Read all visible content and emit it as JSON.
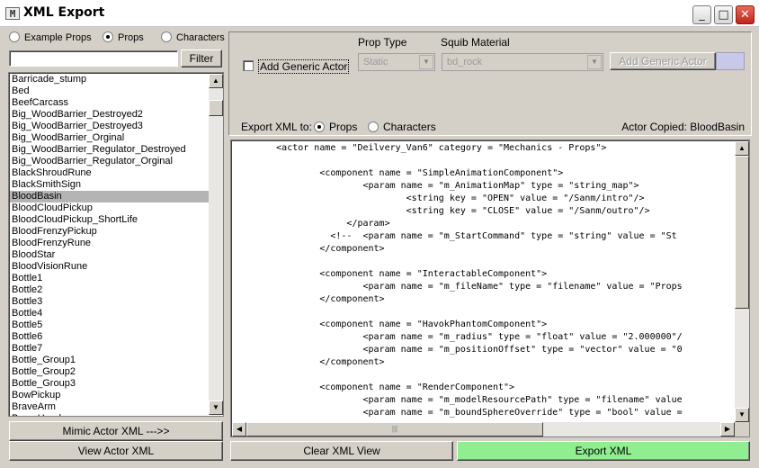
{
  "window": {
    "title": "XML Export",
    "app_icon": "M",
    "buttons": {
      "minimize": "_",
      "maximize": "□",
      "close": "✕"
    }
  },
  "left": {
    "radios": [
      {
        "label": "Example Props",
        "selected": false
      },
      {
        "label": "Props",
        "selected": true
      },
      {
        "label": "Characters",
        "selected": false
      }
    ],
    "filter_value": "",
    "filter_button": "Filter",
    "list_items": [
      "Barricade_stump",
      "Bed",
      "BeefCarcass",
      "Big_WoodBarrier_Destroyed2",
      "Big_WoodBarrier_Destroyed3",
      "Big_WoodBarrier_Orginal",
      "Big_WoodBarrier_Regulator_Destroyed",
      "Big_WoodBarrier_Regulator_Orginal",
      "BlackShroudRune",
      "BlackSmithSign",
      "BloodBasin",
      "BloodCloudPickup",
      "BloodCloudPickup_ShortLife",
      "BloodFrenzyPickup",
      "BloodFrenzyRune",
      "BloodStar",
      "BloodVisionRune",
      "Bottle1",
      "Bottle2",
      "Bottle3",
      "Bottle4",
      "Bottle5",
      "Bottle6",
      "Bottle7",
      "Bottle_Group1",
      "Bottle_Group2",
      "Bottle_Group3",
      "BowPickup",
      "BraveArm",
      "BraveHead"
    ],
    "selected_item": "BloodBasin",
    "mimic_button": "Mimic Actor XML --->>",
    "view_button": "View Actor XML"
  },
  "right": {
    "add_generic_checkbox": "Add Generic Actor",
    "prop_type_label": "Prop Type",
    "prop_type_value": "Static",
    "squib_material_label": "Squib Material",
    "squib_material_value": "bd_rock",
    "add_generic_button": "Add Generic Actor",
    "export_to_label": "Export XML to:",
    "export_radios": [
      {
        "label": "Props",
        "selected": true
      },
      {
        "label": "Characters",
        "selected": false
      }
    ],
    "actor_copied": "Actor Copied: BloodBasin",
    "code_lines": [
      "        <actor name = \"Deilvery_Van6\" category = \"Mechanics - Props\">",
      "",
      "                <component name = \"SimpleAnimationComponent\">",
      "                        <param name = \"m_AnimationMap\" type = \"string_map\">",
      "                                <string key = \"OPEN\" value = \"/Sanm/intro\"/>",
      "                                <string key = \"CLOSE\" value = \"/Sanm/outro\"/>",
      "                     </param>",
      "                  <!--  <param name = \"m_StartCommand\" type = \"string\" value = \"St",
      "                </component>",
      "",
      "                <component name = \"InteractableComponent\">",
      "                        <param name = \"m_fileName\" type = \"filename\" value = \"Props",
      "                </component>",
      "",
      "                <component name = \"HavokPhantomComponent\">",
      "                        <param name = \"m_radius\" type = \"float\" value = \"2.000000\"/",
      "                        <param name = \"m_positionOffset\" type = \"vector\" value = \"0",
      "                </component>",
      "",
      "                <component name = \"RenderComponent\">",
      "                        <param name = \"m_modelResourcePath\" type = \"filename\" value",
      "                        <param name = \"m_boundSphereOverride\" type = \"bool\" value ="
    ],
    "clear_button": "Clear XML View",
    "export_button": "Export XML"
  },
  "scroll_glyphs": {
    "up": "▲",
    "down": "▼",
    "left": "◀",
    "right": "▶",
    "grip": "|||"
  },
  "colors": {
    "export_button_bg": "#90ee90",
    "selected_row": "#b4b4b4",
    "dialog_bg": "#d4d0c8"
  }
}
